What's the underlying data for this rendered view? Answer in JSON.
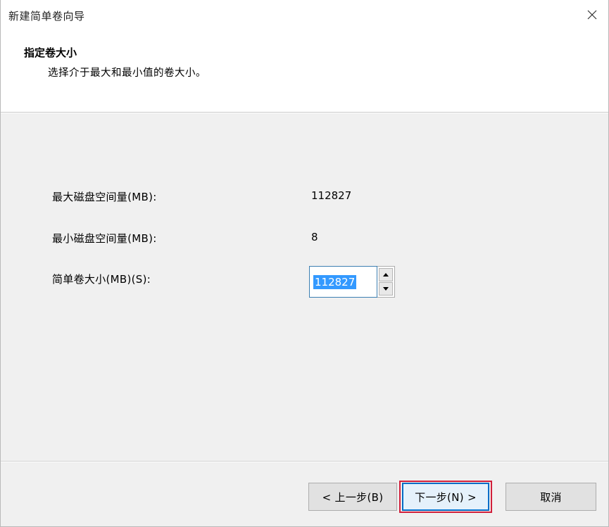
{
  "window": {
    "title": "新建简单卷向导",
    "close_icon": "close-icon"
  },
  "header": {
    "title": "指定卷大小",
    "subtitle": "选择介于最大和最小值的卷大小。"
  },
  "form": {
    "max_label": "最大磁盘空间量(MB):",
    "max_value": "112827",
    "min_label": "最小磁盘空间量(MB):",
    "min_value": "8",
    "size_label": "简单卷大小(MB)(S):",
    "size_value": "112827"
  },
  "buttons": {
    "back": "< 上一步(B)",
    "next": "下一步(N) >",
    "cancel": "取消"
  },
  "colors": {
    "highlight_border": "#d11f3b",
    "selection": "#3399ff",
    "content_bg": "#f0f0f0"
  }
}
